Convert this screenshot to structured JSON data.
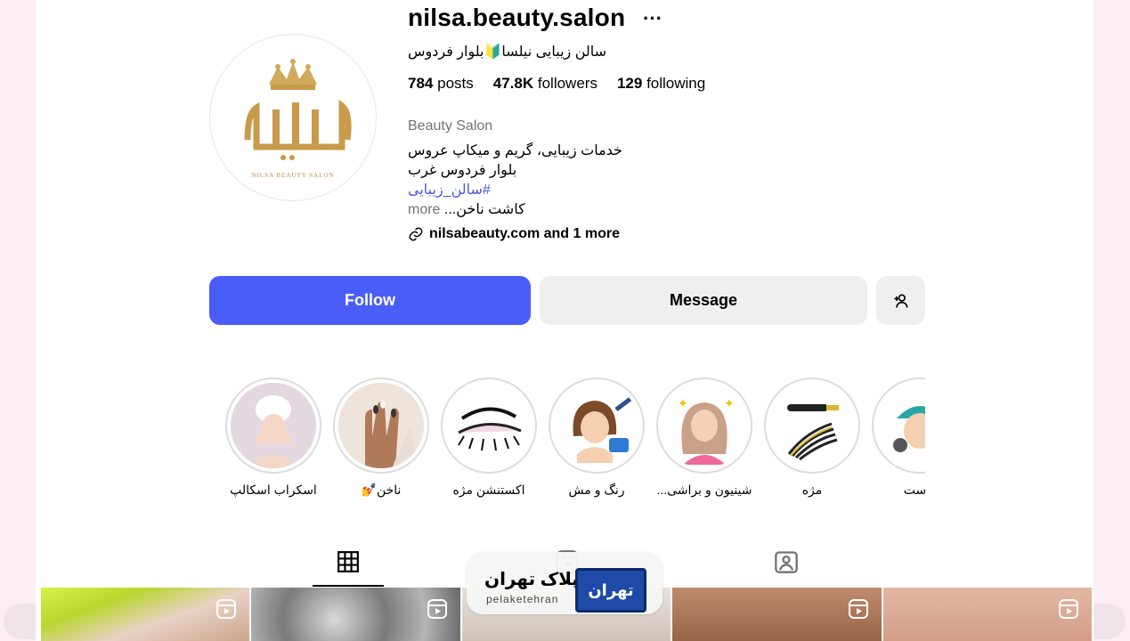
{
  "profile": {
    "username": "nilsa.beauty.salon",
    "more_dots": "···",
    "full_name": "سالن زیبایی نیلسا🔰بلوار فردوس",
    "stats": {
      "posts_count": "784",
      "posts_label": "posts",
      "followers_count": "47.8K",
      "followers_label": "followers",
      "following_count": "129",
      "following_label": "following"
    },
    "category": "Beauty Salon",
    "bio_line1": "خدمات زیبایی، گریم و میکاپ عروس",
    "bio_line2": "بلوار فردوس غرب",
    "bio_hashtag": "#سالن_زیبایی",
    "bio_line4": "کاشت ناخن...",
    "bio_more": "more",
    "link_text": "nilsabeauty.com and 1 more",
    "avatar_logo_text": "نیلسا",
    "avatar_logo_sub": "NILSA BEAUTY SALON"
  },
  "actions": {
    "follow_label": "Follow",
    "message_label": "Message"
  },
  "highlights": [
    {
      "label": "اسکراب اسکالپ"
    },
    {
      "label": "ناخن💅"
    },
    {
      "label": "اکستنشن مژه"
    },
    {
      "label": "رنگ و مش"
    },
    {
      "label": "شینیون و براشی..."
    },
    {
      "label": "مژه"
    },
    {
      "label": "پوست"
    }
  ],
  "watermark": {
    "brand": "پلاک تهران",
    "brand_latin": "pelaketehran",
    "plate_text": "تهران"
  },
  "colors": {
    "follow_bg": "#4a5df9",
    "hashtag": "#4a5bd1",
    "background": "#fdeef5"
  }
}
